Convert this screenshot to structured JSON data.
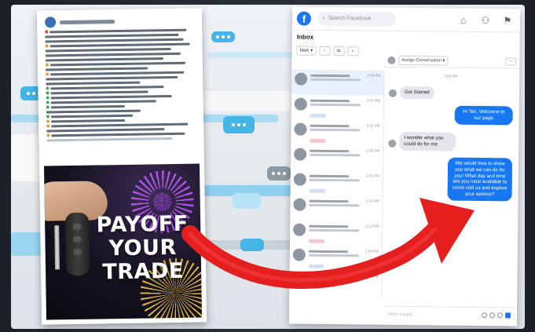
{
  "colors": {
    "messenger_blue": "#1877f2",
    "arrow_red": "#e51e1e",
    "bubble_blue": "#45b5e8"
  },
  "ad": {
    "headline": "PAYOFF YOUR TRADE"
  },
  "messenger": {
    "search_placeholder": "Search Facebook",
    "inbox_title": "Inbox",
    "filter_label": "Mark",
    "assign_label": "Assign Conversation",
    "chat_time": "2:59 PM",
    "messages": [
      {
        "from": "customer",
        "text": "Got Started"
      },
      {
        "from": "page",
        "text": "Hi Teri, Welcome to our page"
      },
      {
        "from": "customer",
        "text": "I wonder what you could do for me"
      },
      {
        "from": "page",
        "text": "We would love to show you what we can do for you! What day and time are you most available to come visit us and explore your options?"
      }
    ],
    "list_times": [
      "2:59 PM",
      "2:47 PM",
      "2:41 PM",
      "2:36 PM",
      "2:31 PM",
      "2:22 PM",
      "2:12 PM",
      "2:04 PM",
      "1:56 PM"
    ],
    "composer_placeholder": "Write a reply..."
  },
  "icons": [
    "facebook-logo-icon",
    "search-icon",
    "home-icon",
    "people-icon",
    "flag-icon",
    "add-icon",
    "filter-icon",
    "search-icon",
    "more-icon",
    "like-icon"
  ]
}
